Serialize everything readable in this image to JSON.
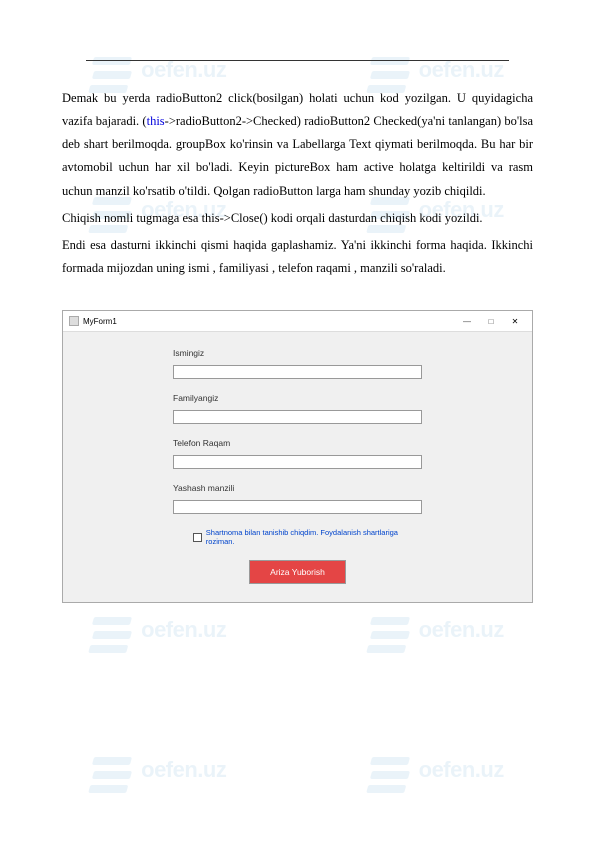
{
  "watermark": "oefen.uz",
  "text": {
    "p1_a": "Demak bu yerda radioButton2 click(bosilgan) holati uchun kod yozilgan. U quyidagicha vazifa bajaradi. (",
    "p1_keyword": "this",
    "p1_b": "->radioButton2->Checked) radioButton2 Checked(ya'ni tanlangan) bo'lsa deb shart berilmoqda. groupBox ko'rinsin va Labellarga Text qiymati berilmoqda. Bu har bir avtomobil uchun har xil bo'ladi. Keyin pictureBox ham active holatga keltirildi va rasm uchun  manzil ko'rsatib o'tildi. Qolgan radioButton larga ham shunday yozib chiqildi.",
    "p2": "Chiqish nomli tugmaga esa this->Close() kodi orqali dasturdan chiqish kodi yozildi.",
    "p3": "Endi esa dasturni ikkinchi qismi haqida gaplashamiz. Ya'ni ikkinchi forma haqida. Ikkinchi formada mijozdan uning ismi , familiyasi , telefon raqami , manzili so'raladi."
  },
  "form": {
    "windowTitle": "MyForm1",
    "minimize": "—",
    "maximize": "□",
    "close": "✕",
    "labels": {
      "name": "Ismingiz",
      "surname": "Familyangiz",
      "phone": "Telefon Raqam",
      "address": "Yashash manzili"
    },
    "checkbox": "Shartnoma bilan tanishib chiqdim. Foydalanish shartlariga roziman.",
    "submit": "Ariza Yuborish"
  }
}
